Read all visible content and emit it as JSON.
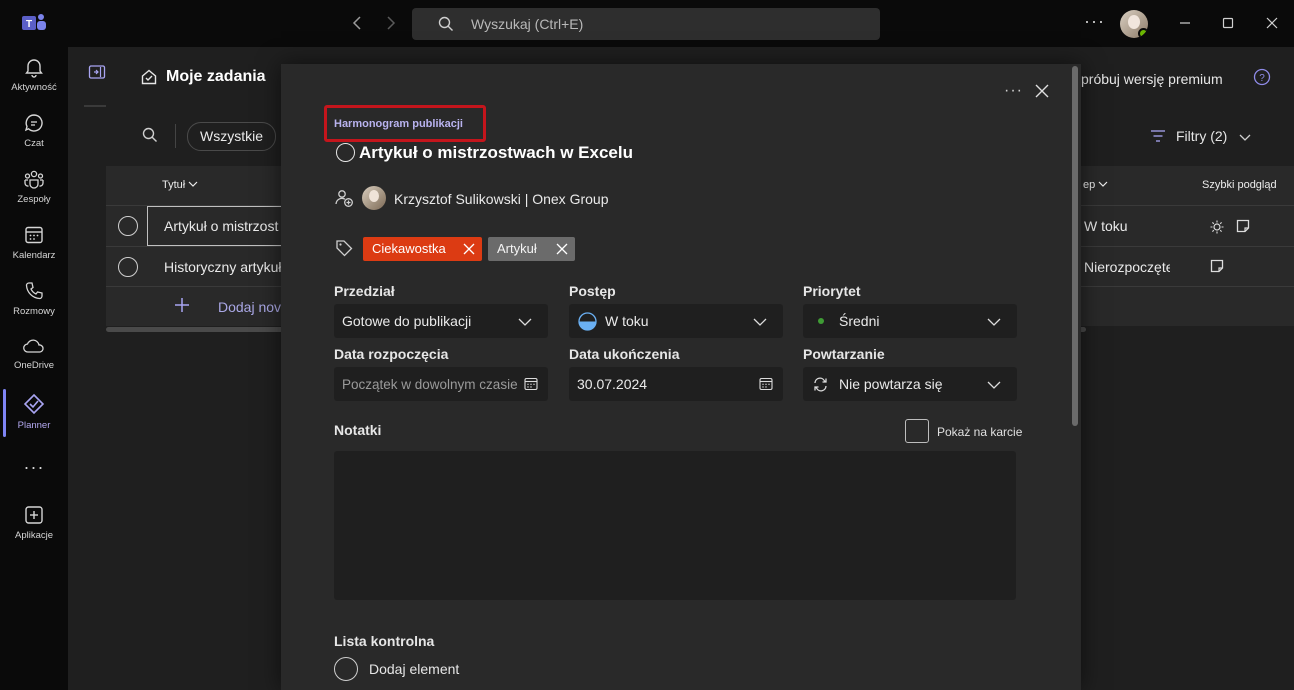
{
  "titlebar": {
    "search_placeholder": "Wyszukaj (Ctrl+E)"
  },
  "rail": {
    "items": [
      {
        "label": "Aktywność",
        "icon": "bell-icon"
      },
      {
        "label": "Czat",
        "icon": "chat-icon"
      },
      {
        "label": "Zespoły",
        "icon": "teams-icon"
      },
      {
        "label": "Kalendarz",
        "icon": "calendar-icon"
      },
      {
        "label": "Rozmowy",
        "icon": "phone-icon"
      },
      {
        "label": "OneDrive",
        "icon": "cloud-icon"
      },
      {
        "label": "Planner",
        "icon": "planner-icon",
        "active": true
      },
      {
        "label": "",
        "icon": "more-icon"
      },
      {
        "label": "Aplikacje",
        "icon": "add-app-icon"
      }
    ]
  },
  "page": {
    "title": "Moje zadania",
    "premium": "próbuj wersję premium",
    "filter_all": "Wszystkie",
    "filters": "Filtry (2)",
    "col_title": "Tytuł",
    "col_progress": "ep",
    "col_quick": "Szybki podgląd",
    "rows": [
      {
        "title": "Artykuł o mistrzost",
        "status": "W toku"
      },
      {
        "title": "Historyczny artykuł",
        "status": "Nierozpoczęte"
      }
    ],
    "add_new": "Dodaj nov"
  },
  "dialog": {
    "plan_name": "Harmonogram publikacji",
    "task_title": "Artykuł o mistrzostwach w Excelu",
    "assignee": "Krzysztof Sulikowski | Onex Group",
    "tags": [
      "Ciekawostka",
      "Artykuł"
    ],
    "fields": {
      "bucket_label": "Przedział",
      "bucket_value": "Gotowe do publikacji",
      "progress_label": "Postęp",
      "progress_value": "W toku",
      "priority_label": "Priorytet",
      "priority_value": "Średni",
      "start_label": "Data rozpoczęcia",
      "start_placeholder": "Początek w dowolnym czasie",
      "due_label": "Data ukończenia",
      "due_value": "30.07.2024",
      "repeat_label": "Powtarzanie",
      "repeat_value": "Nie powtarza się"
    },
    "notes_label": "Notatki",
    "show_on_card": "Pokaż na karcie",
    "checklist_label": "Lista kontrolna",
    "checklist_add": "Dodaj element"
  },
  "colors": {
    "accent": "#7f85f5",
    "highlight": "#c4151c",
    "tag_orange": "#dc3b13",
    "tag_gray": "#6b6b6b"
  }
}
